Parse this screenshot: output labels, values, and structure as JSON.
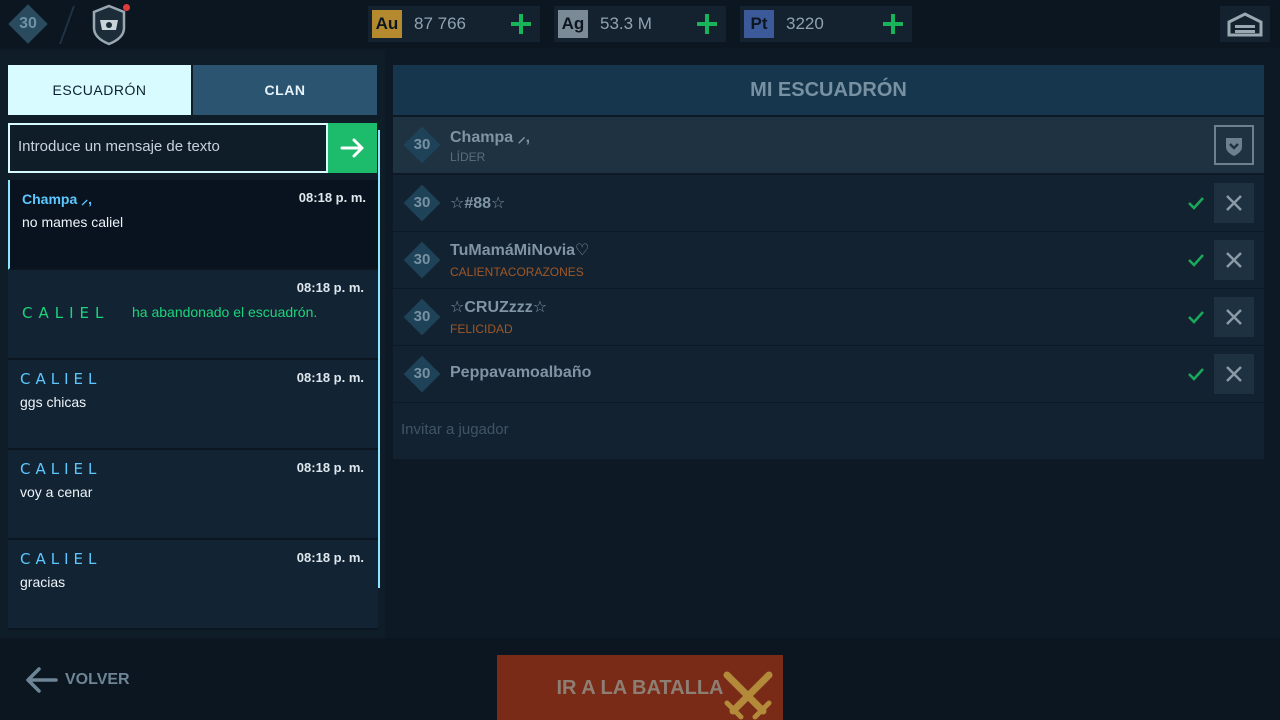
{
  "topbar": {
    "level": "30",
    "currencies": [
      {
        "badge": "Au",
        "value": "87 766",
        "color": "#b5892d"
      },
      {
        "badge": "Ag",
        "value": "53.3 M",
        "color": "#7a8a96"
      },
      {
        "badge": "Pt",
        "value": "3220",
        "color": "#3c5a99"
      }
    ]
  },
  "tabs": {
    "squad": "ESCUADRÓN",
    "clan": "CLAN"
  },
  "chat": {
    "input_placeholder": "Introduce un mensaje de texto",
    "messages": [
      {
        "author": "Champa ⸝,",
        "time": "08:18 p. m.",
        "text": "no mames caliel"
      },
      {
        "author": "CALIEL",
        "time": "08:18 p. m.",
        "text": "ha abandonado el escuadrón."
      },
      {
        "author": "CALIEL",
        "time": "08:18 p. m.",
        "text": "ggs chicas"
      },
      {
        "author": "CALIEL",
        "time": "08:18 p. m.",
        "text": "voy a cenar"
      },
      {
        "author": "CALIEL",
        "time": "08:18 p. m.",
        "text": "gracias"
      }
    ]
  },
  "squad": {
    "title": "MI ESCUADRÓN",
    "members": [
      {
        "level": "30",
        "name": "Champa ⸝,",
        "subtitle": "LÍDER"
      },
      {
        "level": "30",
        "name": "☆#88☆",
        "subtitle": ""
      },
      {
        "level": "30",
        "name": "TuMamáMiNovia♡",
        "subtitle": "CALIENTACORAZONES"
      },
      {
        "level": "30",
        "name": "☆CRUZzzz☆",
        "subtitle": "FELICIDAD"
      },
      {
        "level": "30",
        "name": "Peppavamoalbaño",
        "subtitle": ""
      }
    ],
    "invite_placeholder": "Invitar a jugador"
  },
  "bottom": {
    "back_label": "VOLVER",
    "battle_label": "IR A LA BATALLA"
  },
  "colors": {
    "accent_green": "#1dbb6c",
    "cyan": "#d8fbff",
    "battle": "#7a2b17"
  }
}
